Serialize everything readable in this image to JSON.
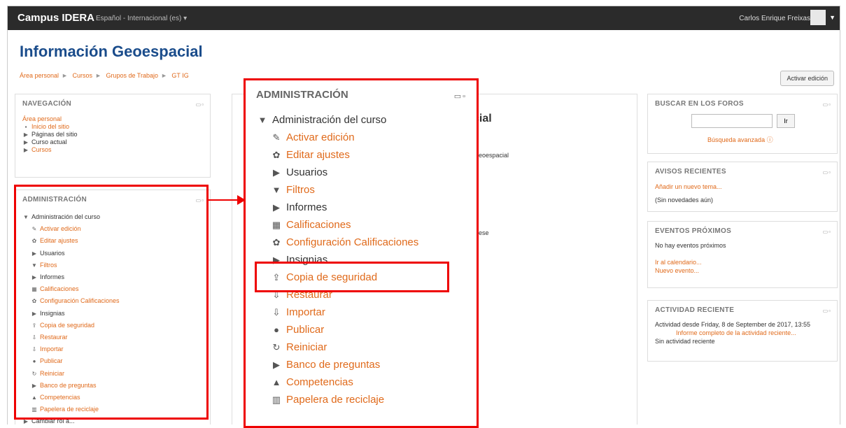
{
  "navbar": {
    "brand": "Campus IDERA",
    "language": "Español - Internacional (es)",
    "user": "Carlos Enrique Freixas"
  },
  "page": {
    "title": "Información Geoespacial",
    "breadcrumb": [
      "Área personal",
      "Cursos",
      "Grupos de Trabajo",
      "GT IG"
    ],
    "edit_button": "Activar edición"
  },
  "navigation": {
    "heading": "NAVEGACIÓN",
    "items": [
      "Área personal",
      "Inicio del sitio",
      "Páginas del sitio",
      "Curso actual",
      "Cursos"
    ]
  },
  "admin": {
    "heading": "ADMINISTRACIÓN",
    "course_admin": "Administración del curso",
    "items": [
      "Activar edición",
      "Editar ajustes",
      "Usuarios",
      "Filtros",
      "Informes",
      "Calificaciones",
      "Configuración Calificaciones",
      "Insignias",
      "Copia de seguridad",
      "Restaurar",
      "Importar",
      "Publicar",
      "Reiniciar",
      "Banco de preguntas",
      "Competencias",
      "Papelera de reciclaje"
    ],
    "role": "Cambiar rol a..."
  },
  "forum_search": {
    "heading": "BUSCAR EN LOS FOROS",
    "button": "Ir",
    "advanced": "Búsqueda avanzada"
  },
  "news": {
    "heading": "AVISOS RECIENTES",
    "add": "Añadir un nuevo tema...",
    "empty": "(Sin novedades aún)"
  },
  "events": {
    "heading": "EVENTOS PRÓXIMOS",
    "empty": "No hay eventos próximos",
    "calendar": "Ir al calendario...",
    "new_event": "Nuevo evento..."
  },
  "activity": {
    "heading": "ACTIVIDAD RECIENTE",
    "since": "Actividad desde Friday, 8 de September de 2017, 13:55",
    "full_report": "Informe completo de la actividad reciente...",
    "none": "Sin actividad reciente"
  },
  "center": {
    "peek_title": "cial",
    "peek_geo": "eoespacial",
    "peek_ese": "ese"
  }
}
